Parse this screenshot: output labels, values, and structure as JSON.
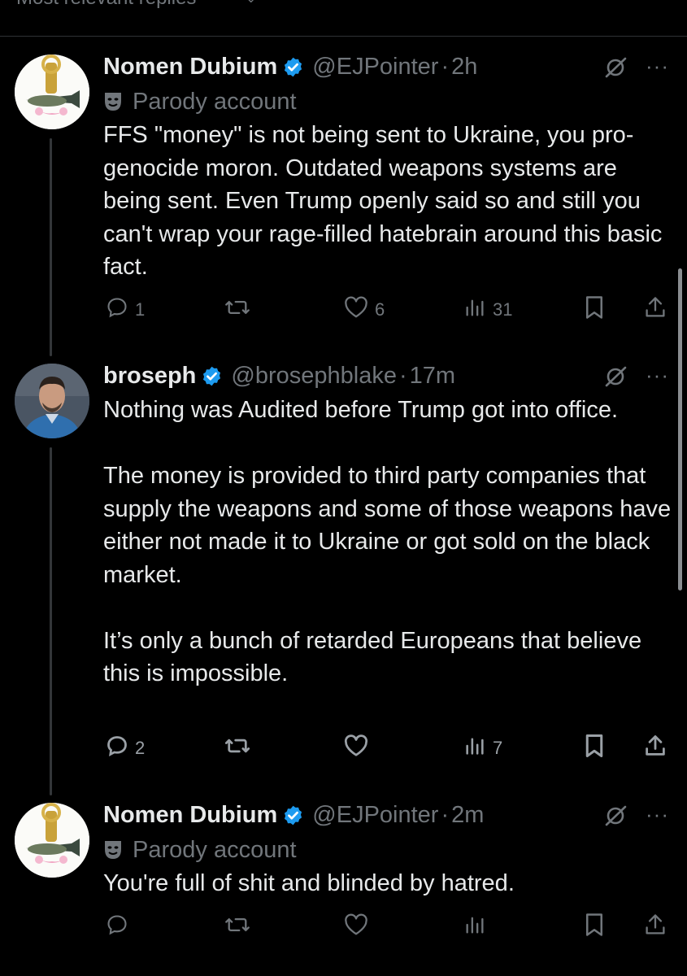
{
  "top_bar": {
    "sort_label": "Most relevant replies"
  },
  "tweets": [
    {
      "name": "Nomen Dubium",
      "handle": "@EJPointer",
      "time": "2h",
      "parody_label": "Parody account",
      "text": "FFS \"money\" is not being sent to Ukraine, you pro-genocide moron.  Outdated weapons systems are being sent.  Even Trump openly said so and still you can't wrap your rage-filled hatebrain around this basic fact.",
      "replies": "1",
      "reposts": "",
      "likes": "6",
      "views": "31"
    },
    {
      "name": "broseph",
      "handle": "@brosephblake",
      "time": "17m",
      "parody_label": "",
      "text": "Nothing was Audited before Trump got into office.\n\nThe money is provided to third party companies that supply the weapons and some of those weapons have either not made it to Ukraine or got sold on the black market.\n\nIt’s only a bunch of retarded Europeans that believe this is impossible.",
      "replies": "2",
      "reposts": "",
      "likes": "",
      "views": "7"
    },
    {
      "name": "Nomen Dubium",
      "handle": "@EJPointer",
      "time": "2m",
      "parody_label": "Parody account",
      "text": "You're full of shit and blinded by hatred.",
      "replies": "",
      "reposts": "",
      "likes": "",
      "views": ""
    }
  ],
  "colors": {
    "background": "#000000",
    "text": "#e7e9ea",
    "secondary": "#71767b",
    "verified": "#1d9bf0",
    "divider": "#2f3336"
  },
  "icons": [
    "verified-badge-icon",
    "parody-mask-icon",
    "mute-icon",
    "more-icon",
    "reply-icon",
    "repost-icon",
    "like-icon",
    "views-icon",
    "bookmark-icon",
    "share-icon"
  ]
}
